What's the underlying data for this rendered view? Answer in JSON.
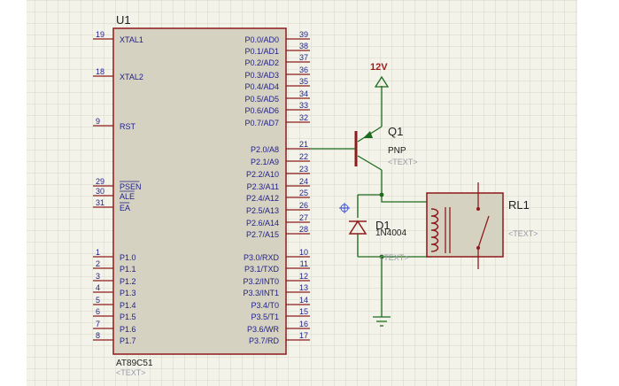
{
  "colors": {
    "grid_bg": "#f3f3ea",
    "grid_line": "#d4d4c6",
    "component_fill": "#d6d2c2",
    "component_outline": "#8e1b1b",
    "wire": "#1d6b1d",
    "pin_text": "#1e1e8a",
    "label_text": "#202020",
    "placeholder_text": "#9a9aa8",
    "power_label": "#9e1b1b"
  },
  "mcu": {
    "ref": "U1",
    "part": "AT89C51",
    "text_placeholder": "<TEXT>",
    "left_pins": [
      {
        "num": "19",
        "name": "XTAL1",
        "overbar": false
      },
      {
        "num": "18",
        "name": "XTAL2",
        "overbar": false
      },
      {
        "num": "9",
        "name": "RST",
        "overbar": false
      },
      {
        "num": "29",
        "name": "PSEN",
        "overbar": true
      },
      {
        "num": "30",
        "name": "ALE",
        "overbar": true
      },
      {
        "num": "31",
        "name": "EA",
        "overbar": true
      },
      {
        "num": "1",
        "name": "P1.0",
        "overbar": false
      },
      {
        "num": "2",
        "name": "P1.1",
        "overbar": false
      },
      {
        "num": "3",
        "name": "P1.2",
        "overbar": false
      },
      {
        "num": "4",
        "name": "P1.3",
        "overbar": false
      },
      {
        "num": "5",
        "name": "P1.4",
        "overbar": false
      },
      {
        "num": "6",
        "name": "P1.5",
        "overbar": false
      },
      {
        "num": "7",
        "name": "P1.6",
        "overbar": false
      },
      {
        "num": "8",
        "name": "P1.7",
        "overbar": false
      }
    ],
    "right_pins": [
      {
        "num": "39",
        "name": "P0.0/AD0"
      },
      {
        "num": "38",
        "name": "P0.1/AD1"
      },
      {
        "num": "37",
        "name": "P0.2/AD2"
      },
      {
        "num": "36",
        "name": "P0.3/AD3"
      },
      {
        "num": "35",
        "name": "P0.4/AD4"
      },
      {
        "num": "34",
        "name": "P0.5/AD5"
      },
      {
        "num": "33",
        "name": "P0.6/AD6"
      },
      {
        "num": "32",
        "name": "P0.7/AD7"
      },
      {
        "num": "21",
        "name": "P2.0/A8"
      },
      {
        "num": "22",
        "name": "P2.1/A9"
      },
      {
        "num": "23",
        "name": "P2.2/A10"
      },
      {
        "num": "24",
        "name": "P2.3/A11"
      },
      {
        "num": "25",
        "name": "P2.4/A12"
      },
      {
        "num": "26",
        "name": "P2.5/A13"
      },
      {
        "num": "27",
        "name": "P2.6/A14"
      },
      {
        "num": "28",
        "name": "P2.7/A15"
      },
      {
        "num": "10",
        "name": "P3.0/RXD"
      },
      {
        "num": "11",
        "name": "P3.1/TXD"
      },
      {
        "num": "12",
        "name": "P3.2/INT0"
      },
      {
        "num": "13",
        "name": "P3.3/INT1"
      },
      {
        "num": "14",
        "name": "P3.4/T0"
      },
      {
        "num": "15",
        "name": "P3.5/T1"
      },
      {
        "num": "16",
        "name": "P3.6/WR"
      },
      {
        "num": "17",
        "name": "P3.7/RD"
      }
    ]
  },
  "power": {
    "label": "12V"
  },
  "transistor": {
    "ref": "Q1",
    "type": "PNP",
    "text_placeholder": "<TEXT>"
  },
  "diode": {
    "ref": "D1",
    "part": "1N4004",
    "text_placeholder": "<TEXT>"
  },
  "relay": {
    "ref": "RL1",
    "text_placeholder": "<TEXT>"
  }
}
